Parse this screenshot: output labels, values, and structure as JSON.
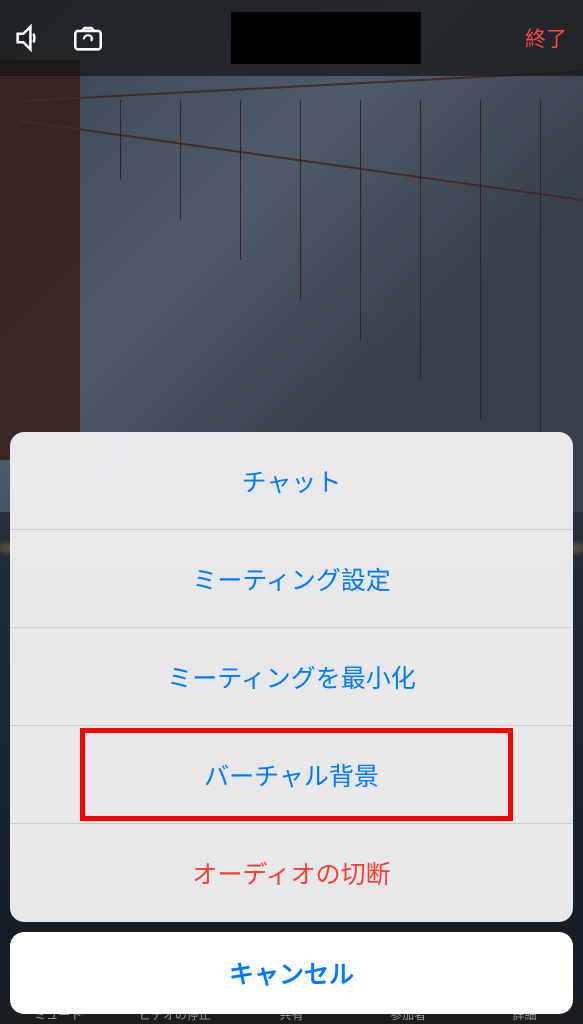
{
  "top_bar": {
    "end_label": "終了"
  },
  "action_sheet": {
    "items": [
      {
        "label": "チャット",
        "destructive": false,
        "highlighted": false
      },
      {
        "label": "ミーティング設定",
        "destructive": false,
        "highlighted": false
      },
      {
        "label": "ミーティングを最小化",
        "destructive": false,
        "highlighted": false
      },
      {
        "label": "バーチャル背景",
        "destructive": false,
        "highlighted": true
      },
      {
        "label": "オーディオの切断",
        "destructive": true,
        "highlighted": false
      }
    ],
    "cancel_label": "キャンセル"
  },
  "bottom_bar": {
    "items": [
      "ミュート",
      "ビデオの停止",
      "共有",
      "参加者",
      "詳細"
    ]
  },
  "colors": {
    "primary_blue": "#007aff",
    "destructive_red": "#ff3b30",
    "end_red": "#ff4545",
    "highlight_box": "#ff0000"
  }
}
